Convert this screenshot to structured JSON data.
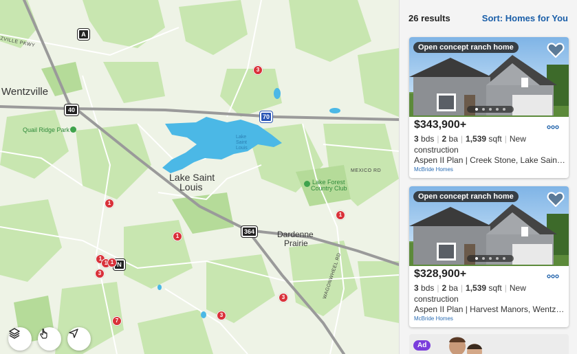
{
  "map": {
    "cities": {
      "wentzville": "Wentzville",
      "lake_saint_louis_1": "Lake Saint",
      "lake_saint_louis_2": "Louis",
      "dardenne_1": "Dardenne",
      "dardenne_2": "Prairie"
    },
    "labels": {
      "quail_ridge": "Quail Ridge Park",
      "lake_forest_1": "Lake Forest",
      "lake_forest_2": "Country Club",
      "lake_1": "Lake",
      "lake_2": "Saint",
      "lake_3": "Louis",
      "mexico_rd": "MEXICO RD",
      "wzville_pkwy": "ZVILLE PKWY",
      "wagonwheel": "WAGONWHEEL RD"
    },
    "shields": {
      "a": "A",
      "i40": "40",
      "i70": "70",
      "r364": "364",
      "n": "N"
    },
    "pins": [
      "3",
      "1",
      "1",
      "1",
      "1",
      "1",
      "1",
      "3",
      "3",
      "3",
      "7"
    ],
    "controls": {
      "layers": "layers-icon",
      "draw": "hand-pointer-icon",
      "locate": "navigation-arrow-icon"
    }
  },
  "panel": {
    "results": "26 results",
    "sort": "Sort: Homes for You",
    "listings": [
      {
        "tag": "Open concept ranch home",
        "price": "$343,900+",
        "beds": "3",
        "beds_unit": "bds",
        "baths": "2",
        "baths_unit": "ba",
        "sqft": "1,539",
        "sqft_unit": "sqft",
        "status": "New construction",
        "address": "Aspen II Plan | Creek Stone, Lake Saint…",
        "builder": "McBride Homes"
      },
      {
        "tag": "Open concept ranch home",
        "price": "$328,900+",
        "beds": "3",
        "beds_unit": "bds",
        "baths": "2",
        "baths_unit": "ba",
        "sqft": "1,539",
        "sqft_unit": "sqft",
        "status": "New construction",
        "address": "Aspen II Plan | Harvest Manors, Wentz…",
        "builder": "McBride Homes"
      }
    ],
    "ad_badge": "Ad"
  },
  "colors": {
    "pin": "#d9323a",
    "link": "#1a5ea8",
    "water": "#4bb8e6",
    "park": "#bfe0a6",
    "ad": "#7a3ddc"
  }
}
